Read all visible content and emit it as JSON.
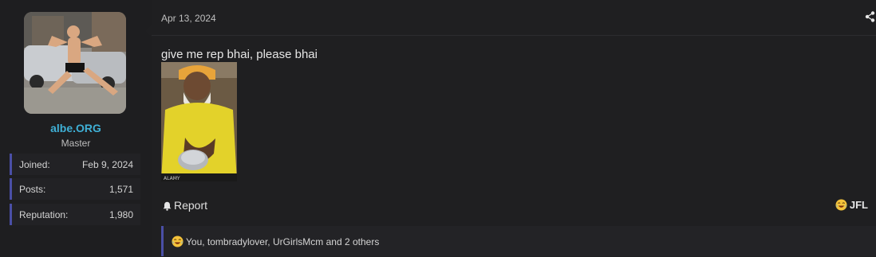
{
  "user": {
    "name": "albe.ORG",
    "title": "Master",
    "stats": [
      {
        "label": "Joined:",
        "value": "Feb 9, 2024"
      },
      {
        "label": "Posts:",
        "value": "1,571"
      },
      {
        "label": "Reputation:",
        "value": "1,980"
      }
    ]
  },
  "post": {
    "date": "Apr 13, 2024",
    "message": "give me rep bhai, please bhai",
    "image_watermark": "ALAMY"
  },
  "actions": {
    "report_label": "Report",
    "reaction_label": "JFL"
  },
  "reactions": {
    "summary": "You, tombradylover, UrGirlsMcm and 2 others"
  },
  "colors": {
    "accent": "#4a4fa6",
    "username": "#3fb0d6",
    "background": "#191919"
  }
}
